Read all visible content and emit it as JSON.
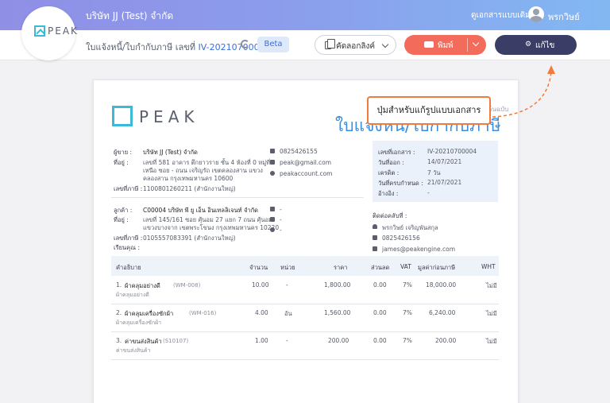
{
  "header": {
    "company": "บริษัท JJ (Test) จำกัด",
    "legacy_link": "ดูเอกสารแบบเดิม",
    "user_name": "พรกวิษย์"
  },
  "logo_text": "PEAK",
  "subbar": {
    "doc_title_prefix": "ใบแจ้งหนี้/ใบกำกับภาษี เลขที่",
    "doc_number": "IV-20210700004",
    "beta_label": "Beta",
    "copy_link_label": "คัดลอกลิงค์",
    "print_label": "พิมพ์",
    "edit_label": "แก้ไข"
  },
  "document": {
    "original_label": "ต้นฉบับ",
    "title": "ใบแจ้งหนี้/ใบกำกับภาษี",
    "callout": "ปุ่มสำหรับแก้รูปแบบเอกสาร",
    "seller": {
      "label": "ผู้ขาย :",
      "name": "บริษัท JJ (Test) จำกัด",
      "address_label": "ที่อยู่ :",
      "address_lines": [
        "เลขที่ 581 อาคาร ตึกยาวราย ชั้น 4 ห้องที่ 0 หมู่ที่",
        "เหนือ ซอย - ถนน เจริญรัถ เขตคลองสาน แขวง",
        "คลองสาน กรุงเทพมหานคร 10600"
      ],
      "tax_label": "เลขที่ภาษี :",
      "tax_id": "1100801260211 (สำนักงานใหญ่)",
      "phone": "0825426155",
      "email": "peak@gmail.com",
      "website": "peakaccount.com"
    },
    "customer": {
      "label": "ลูกค้า :",
      "name": "C00004 บริษัท พี ยู เอ็น อินเทลลิเจนท์ จำกัด",
      "address_label": "ที่อยู่ :",
      "address_lines": [
        "เลขที่ 145/161 ซอย ศุ้นอม 27 แยก 7 ถนน ศุ้นอม",
        "แขวงบางจาก เขตพระโขนง กรุงเทพมหานคร 10220"
      ],
      "tax_label": "เลขที่ภาษี :",
      "tax_id": "0105557083391 (สำนักงานใหญ่)",
      "attention_label": "เรียนคุณ :",
      "phone": "-",
      "email": "-",
      "website": "-"
    },
    "info": [
      {
        "label": "เลขที่เอกสาร :",
        "value": "IV-20210700004"
      },
      {
        "label": "วันที่ออก :",
        "value": "14/07/2021"
      },
      {
        "label": "เครดิต :",
        "value": "7 วัน"
      },
      {
        "label": "วันที่ครบกำหนด :",
        "value": "21/07/2021"
      },
      {
        "label": "อ้างอิง :",
        "value": "-"
      }
    ],
    "contact": {
      "label": "ติดต่อคลับที่ :",
      "name": "พรกวิษย์ เจริญพันสกุล",
      "phone": "0825426156",
      "email": "james@peakengine.com"
    },
    "table": {
      "headers": [
        "คำอธิบาย",
        "จำนวน",
        "หน่วย",
        "ราคา",
        "ส่วนลด",
        "VAT",
        "มูลค่าก่อนภาษี",
        "WHT"
      ],
      "rows": [
        {
          "no": "1.",
          "name": "ผ้าคลุมอย่างดี",
          "code": "(WM-008)",
          "desc": "ผ้าคลุมอย่างดี",
          "qty": "10.00",
          "unit": "-",
          "price": "1,800.00",
          "discount": "0.00",
          "vat": "7%",
          "amount": "18,000.00",
          "wht": "ไม่มี"
        },
        {
          "no": "2.",
          "name": "ผ้าคลุมเครื่องซักผ้า",
          "code": "(WM-016)",
          "desc": "ผ้าคลุมเครื่องซักผ้า",
          "qty": "4.00",
          "unit": "อัน",
          "price": "1,560.00",
          "discount": "0.00",
          "vat": "7%",
          "amount": "6,240.00",
          "wht": "ไม่มี"
        },
        {
          "no": "3.",
          "name": "ค่าขนส่งสินค้า",
          "code": "(S10107)",
          "desc": "ค่าขนส่งสินค้า",
          "qty": "1.00",
          "unit": "-",
          "price": "200.00",
          "discount": "0.00",
          "vat": "7%",
          "amount": "200.00",
          "wht": "ไม่มี"
        }
      ]
    }
  },
  "colors": {
    "accent": "#3b8ee0",
    "print_button": "#f26b5b",
    "edit_button": "#3a3d66",
    "callout_border": "#f07b3c"
  }
}
